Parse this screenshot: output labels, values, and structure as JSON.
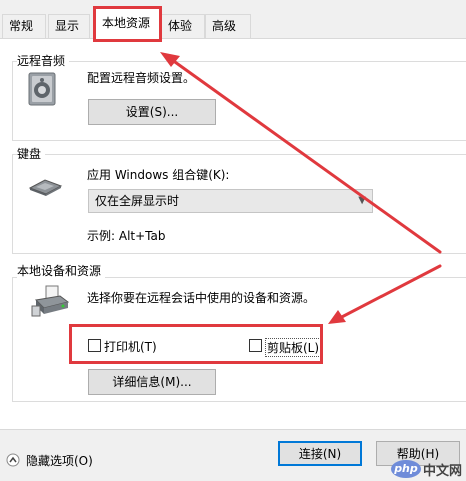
{
  "tabs": [
    {
      "label": "常规"
    },
    {
      "label": "显示"
    },
    {
      "label": "本地资源"
    },
    {
      "label": "体验"
    },
    {
      "label": "高级"
    }
  ],
  "remote_audio": {
    "title": "远程音频",
    "description": "配置远程音频设置。",
    "settings_button": "设置(S)..."
  },
  "keyboard": {
    "title": "键盘",
    "apply_label": "应用 Windows 组合键(K):",
    "selected_option": "仅在全屏显示时",
    "example": "示例: Alt+Tab"
  },
  "local_devices": {
    "title": "本地设备和资源",
    "description": "选择你要在远程会话中使用的设备和资源。",
    "printer_label": "打印机(T)",
    "clipboard_label": "剪贴板(L)",
    "details_button": "详细信息(M)..."
  },
  "footer": {
    "hide_options": "隐藏选项(O)",
    "connect_button": "连接(N)",
    "help_button": "帮助(H)"
  },
  "watermark": {
    "logo": "php",
    "text": "中文网"
  },
  "colors": {
    "annotation_red": "#e0393e",
    "primary_blue": "#0078d7"
  }
}
